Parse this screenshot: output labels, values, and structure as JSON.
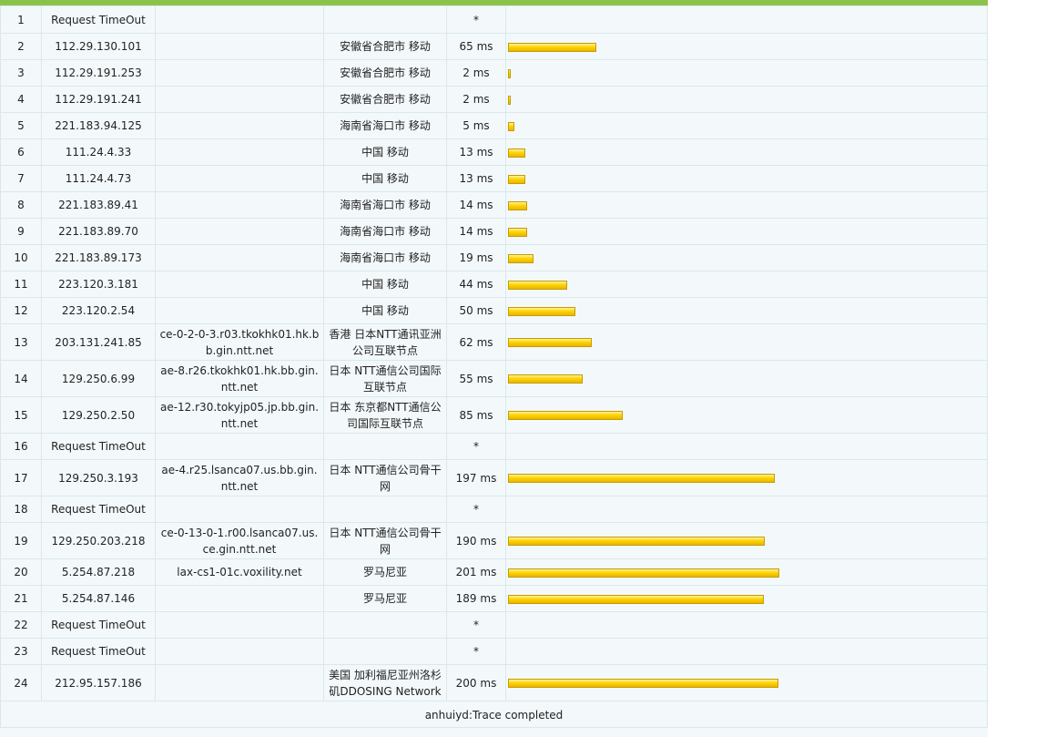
{
  "rows": [
    {
      "hop": "1",
      "ip": "Request TimeOut",
      "host": "",
      "location": "",
      "time": "*",
      "ms": 0
    },
    {
      "hop": "2",
      "ip": "112.29.130.101",
      "host": "",
      "location": "安徽省合肥市 移动",
      "time": "65 ms",
      "ms": 65
    },
    {
      "hop": "3",
      "ip": "112.29.191.253",
      "host": "",
      "location": "安徽省合肥市 移动",
      "time": "2 ms",
      "ms": 2
    },
    {
      "hop": "4",
      "ip": "112.29.191.241",
      "host": "",
      "location": "安徽省合肥市 移动",
      "time": "2 ms",
      "ms": 2
    },
    {
      "hop": "5",
      "ip": "221.183.94.125",
      "host": "",
      "location": "海南省海口市 移动",
      "time": "5 ms",
      "ms": 5
    },
    {
      "hop": "6",
      "ip": "111.24.4.33",
      "host": "",
      "location": "中国 移动",
      "time": "13 ms",
      "ms": 13
    },
    {
      "hop": "7",
      "ip": "111.24.4.73",
      "host": "",
      "location": "中国 移动",
      "time": "13 ms",
      "ms": 13
    },
    {
      "hop": "8",
      "ip": "221.183.89.41",
      "host": "",
      "location": "海南省海口市 移动",
      "time": "14 ms",
      "ms": 14
    },
    {
      "hop": "9",
      "ip": "221.183.89.70",
      "host": "",
      "location": "海南省海口市 移动",
      "time": "14 ms",
      "ms": 14
    },
    {
      "hop": "10",
      "ip": "221.183.89.173",
      "host": "",
      "location": "海南省海口市 移动",
      "time": "19 ms",
      "ms": 19
    },
    {
      "hop": "11",
      "ip": "223.120.3.181",
      "host": "",
      "location": "中国 移动",
      "time": "44 ms",
      "ms": 44
    },
    {
      "hop": "12",
      "ip": "223.120.2.54",
      "host": "",
      "location": "中国 移动",
      "time": "50 ms",
      "ms": 50
    },
    {
      "hop": "13",
      "ip": "203.131.241.85",
      "host": "ce-0-2-0-3.r03.tkokhk01.hk.bb.gin.ntt.net",
      "location": "香港 日本NTT通讯亚洲公司互联节点",
      "time": "62 ms",
      "ms": 62
    },
    {
      "hop": "14",
      "ip": "129.250.6.99",
      "host": "ae-8.r26.tkokhk01.hk.bb.gin.ntt.net",
      "location": "日本 NTT通信公司国际互联节点",
      "time": "55 ms",
      "ms": 55
    },
    {
      "hop": "15",
      "ip": "129.250.2.50",
      "host": "ae-12.r30.tokyjp05.jp.bb.gin.ntt.net",
      "location": "日本 东京都NTT通信公司国际互联节点",
      "time": "85 ms",
      "ms": 85
    },
    {
      "hop": "16",
      "ip": "Request TimeOut",
      "host": "",
      "location": "",
      "time": "*",
      "ms": 0
    },
    {
      "hop": "17",
      "ip": "129.250.3.193",
      "host": "ae-4.r25.lsanca07.us.bb.gin.ntt.net",
      "location": "日本 NTT通信公司骨干网",
      "time": "197 ms",
      "ms": 197
    },
    {
      "hop": "18",
      "ip": "Request TimeOut",
      "host": "",
      "location": "",
      "time": "*",
      "ms": 0
    },
    {
      "hop": "19",
      "ip": "129.250.203.218",
      "host": "ce-0-13-0-1.r00.lsanca07.us.ce.gin.ntt.net",
      "location": "日本 NTT通信公司骨干网",
      "time": "190 ms",
      "ms": 190
    },
    {
      "hop": "20",
      "ip": "5.254.87.218",
      "host": "lax-cs1-01c.voxility.net",
      "location": "罗马尼亚",
      "time": "201 ms",
      "ms": 201
    },
    {
      "hop": "21",
      "ip": "5.254.87.146",
      "host": "",
      "location": "罗马尼亚",
      "time": "189 ms",
      "ms": 189
    },
    {
      "hop": "22",
      "ip": "Request TimeOut",
      "host": "",
      "location": "",
      "time": "*",
      "ms": 0
    },
    {
      "hop": "23",
      "ip": "Request TimeOut",
      "host": "",
      "location": "",
      "time": "*",
      "ms": 0
    },
    {
      "hop": "24",
      "ip": "212.95.157.186",
      "host": "",
      "location": "美国 加利福尼亚州洛杉矶DDOSING Network",
      "time": "200 ms",
      "ms": 200
    }
  ],
  "summary": "anhuiyd:Trace completed",
  "colors": {
    "accent": "#8bc34a",
    "bar": "#ffd400"
  }
}
